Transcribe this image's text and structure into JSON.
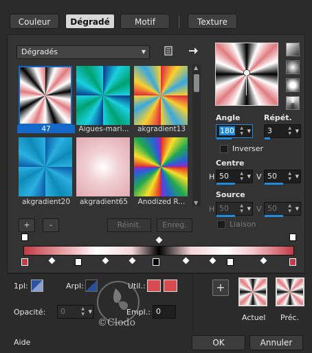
{
  "tabs": [
    {
      "label": "Couleur",
      "active": false
    },
    {
      "label": "Dégradé",
      "active": true
    },
    {
      "label": "Motif",
      "active": false
    },
    {
      "label": "Texture",
      "active": false
    }
  ],
  "library": {
    "selected": "Dégradés",
    "icons": {
      "browse": "document-icon",
      "next": "arrow-right-icon"
    }
  },
  "thumbnails": [
    {
      "label": "47",
      "selected": true
    },
    {
      "label": "Aigues-mari..."
    },
    {
      "label": "akgradient13"
    },
    {
      "label": "akgradient20"
    },
    {
      "label": "akgradient65"
    },
    {
      "label": "Anodized R..."
    }
  ],
  "thumb_buttons": {
    "add": "+",
    "remove": "-",
    "reset": "Réinit.",
    "save": "Enreg."
  },
  "angle": {
    "label": "Angle",
    "value": "180"
  },
  "repeat": {
    "label": "Répét.",
    "value": "3"
  },
  "invert": {
    "label": "Inverser",
    "checked": false
  },
  "center": {
    "label": "Centre",
    "h_label": "H",
    "h_value": "50",
    "v_label": "V",
    "v_value": "50"
  },
  "source": {
    "label": "Source",
    "h_label": "H",
    "h_value": "50",
    "v_label": "V",
    "v_value": "50"
  },
  "link": {
    "label": "Liaison",
    "checked": false
  },
  "stops_row": {
    "left_label": "1pl:",
    "arpl_label": "Arpl:",
    "util_label": "Util.:",
    "opacity_label": "Opacité:",
    "opacity_value": "0",
    "empl_label": "Empl.:",
    "empl_value": "0"
  },
  "previews": {
    "current_label": "Actuel",
    "previous_label": "Préc.",
    "add": "+"
  },
  "footer": {
    "help": "Aide",
    "ok": "OK",
    "cancel": "Annuler"
  },
  "watermark": "©Clodo",
  "colors": {
    "accent": "#1f8be0",
    "stop_red": "#d84c50",
    "selection": "#1468c8"
  }
}
